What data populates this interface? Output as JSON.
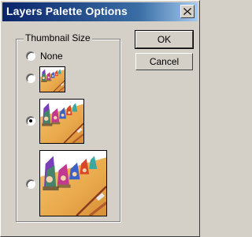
{
  "window": {
    "title": "Layers Palette Options",
    "close_icon": "close-icon"
  },
  "thumbnail_group": {
    "label": "Thumbnail Size",
    "options": [
      {
        "label": "None",
        "selected": false
      },
      {
        "label": "",
        "selected": false,
        "thumbnail": "small"
      },
      {
        "label": "",
        "selected": true,
        "thumbnail": "medium"
      },
      {
        "label": "",
        "selected": false,
        "thumbnail": "large"
      }
    ]
  },
  "buttons": {
    "ok_label": "OK",
    "cancel_label": "Cancel"
  }
}
